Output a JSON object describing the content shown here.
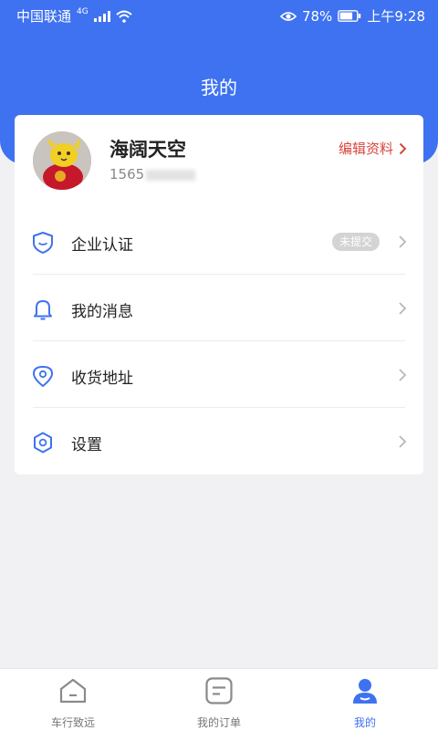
{
  "status_bar": {
    "carrier": "中国联通",
    "network": "4G",
    "battery": "78%",
    "time": "上午9:28"
  },
  "header": {
    "title": "我的"
  },
  "profile": {
    "name": "海阔天空",
    "phone_prefix": "1565",
    "edit_label": "编辑资料"
  },
  "menu": [
    {
      "label": "企业认证",
      "icon": "shield-icon",
      "badge": "未提交"
    },
    {
      "label": "我的消息",
      "icon": "bell-icon"
    },
    {
      "label": "收货地址",
      "icon": "location-pin-icon"
    },
    {
      "label": "设置",
      "icon": "hexagon-settings-icon"
    }
  ],
  "tabbar": [
    {
      "label": "车行致远",
      "icon": "home-icon"
    },
    {
      "label": "我的订单",
      "icon": "order-list-icon"
    },
    {
      "label": "我的",
      "icon": "user-icon",
      "active": true
    }
  ],
  "colors": {
    "accent": "#3e72f0",
    "edit_link": "#d8453b",
    "badge_bg": "#d4d4d4"
  }
}
